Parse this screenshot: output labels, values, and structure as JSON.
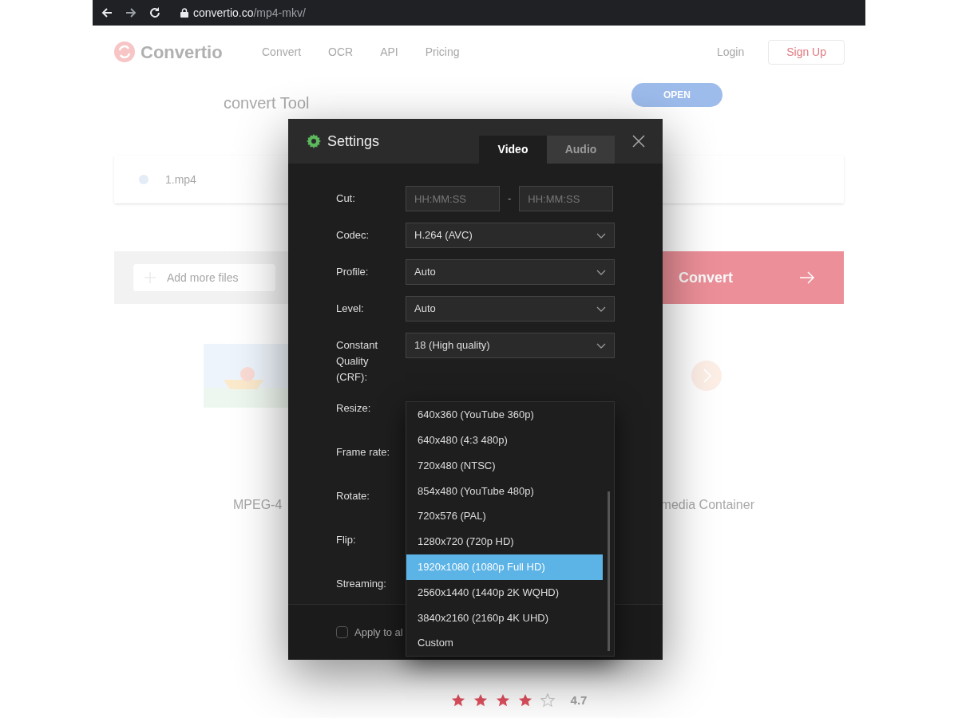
{
  "browser": {
    "url_host": "convertio.co",
    "url_path": "/mp4-mkv/"
  },
  "site": {
    "logo": "Convertio",
    "nav": [
      "Convert",
      "OCR",
      "API",
      "Pricing"
    ],
    "login": "Login",
    "signup": "Sign Up"
  },
  "ad": {
    "title": "convert Tool",
    "button": "OPEN"
  },
  "file": {
    "name": "1.mp4"
  },
  "actions": {
    "add_files": "Add more files",
    "convert": "Convert"
  },
  "formats": {
    "left": "MPEG-4",
    "right": "media Container"
  },
  "rating": {
    "stars": 4,
    "score": "4.7"
  },
  "settings": {
    "title": "Settings",
    "tabs": [
      {
        "label": "Video",
        "selected": true
      },
      {
        "label": "Audio",
        "selected": false
      }
    ],
    "rows": [
      {
        "label": "Cut:",
        "kind": "time",
        "placeholders": [
          "HH:MM:SS",
          "HH:MM:SS"
        ],
        "separator": "-"
      },
      {
        "label": "Codec:",
        "kind": "select",
        "value": "H.264 (AVC)"
      },
      {
        "label": "Profile:",
        "kind": "select",
        "value": "Auto"
      },
      {
        "label": "Level:",
        "kind": "select",
        "value": "Auto"
      },
      {
        "label": "Constant Quality (CRF):",
        "kind": "select",
        "value": "18 (High quality)"
      },
      {
        "label": "Resize:",
        "kind": "covered"
      },
      {
        "label": "Frame rate:",
        "kind": "covered"
      },
      {
        "label": "Rotate:",
        "kind": "covered"
      },
      {
        "label": "Flip:",
        "kind": "covered"
      },
      {
        "label": "Streaming:",
        "kind": "covered"
      }
    ],
    "apply_all": {
      "label": "Apply to al",
      "checked": false
    },
    "dropdown": [
      {
        "label": "640x360 (YouTube 360p)",
        "selected": false
      },
      {
        "label": "640x480 (4:3 480p)",
        "selected": false
      },
      {
        "label": "720x480 (NTSC)",
        "selected": false
      },
      {
        "label": "854x480 (YouTube 480p)",
        "selected": false
      },
      {
        "label": "720x576 (PAL)",
        "selected": false
      },
      {
        "label": "1280x720 (720p HD)",
        "selected": false
      },
      {
        "label": "1920x1080 (1080p Full HD)",
        "selected": true
      },
      {
        "label": "2560x1440 (1440p 2K WQHD)",
        "selected": false
      },
      {
        "label": "3840x2160 (2160p 4K UHD)",
        "selected": false
      },
      {
        "label": "Custom",
        "selected": false
      }
    ]
  }
}
